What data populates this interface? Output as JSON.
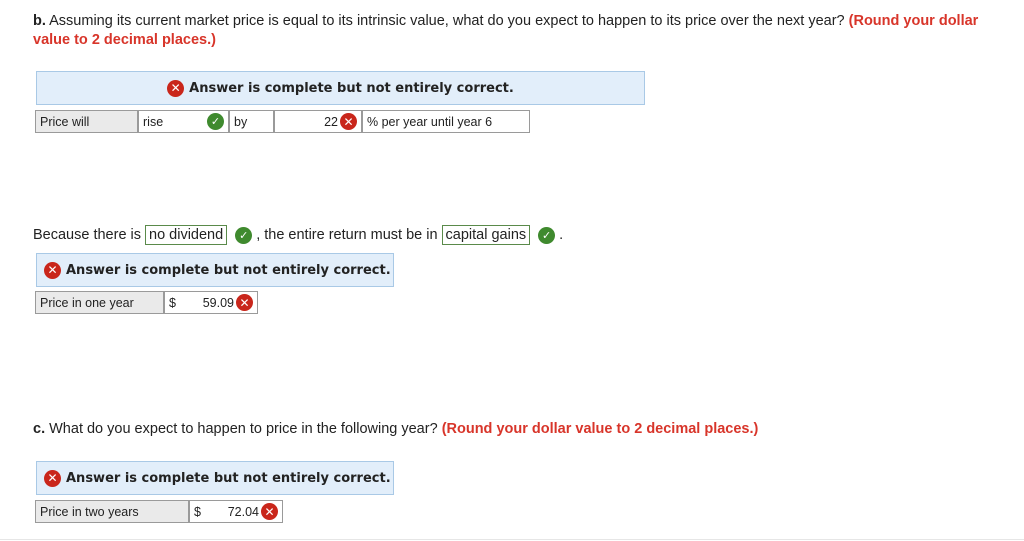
{
  "part_b": {
    "label": "b.",
    "question": "Assuming its current market price is equal to its intrinsic value, what do you expect to happen to its price over the next year?",
    "hint": "(Round your dollar value to 2 decimal places.)",
    "banner": "Answer is complete but not entirely correct.",
    "row": {
      "label": "Price will",
      "choice": "rise",
      "by": "by",
      "value": "22",
      "suffix": "% per year until year 6"
    },
    "sentence": {
      "prefix": "Because there is",
      "choice1": "no dividend",
      "middle": ", the entire return must be in",
      "choice2": "capital gains",
      "end": "."
    },
    "banner2": "Answer is complete but not entirely correct.",
    "row2": {
      "label": "Price in one year",
      "currency": "$",
      "value": "59.09"
    }
  },
  "part_c": {
    "label": "c.",
    "question": "What do you expect to happen to price in the following year?",
    "hint": "(Round your dollar value to 2 decimal places.)",
    "banner": "Answer is complete but not entirely correct.",
    "row": {
      "label": "Price in two years",
      "currency": "$",
      "value": "72.04"
    }
  },
  "icons": {
    "incorrect": "x-circle-icon",
    "correct": "check-circle-icon"
  },
  "colors": {
    "incorrect": "#c9261b",
    "correct": "#3f8a2e",
    "hint": "#d8352a",
    "banner_bg": "#e2eefa"
  }
}
